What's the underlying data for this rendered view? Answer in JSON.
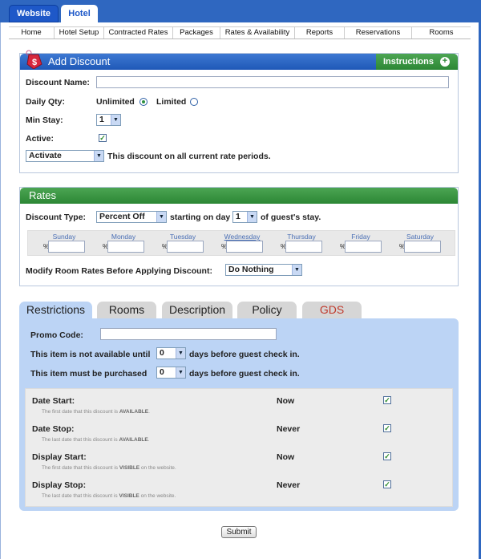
{
  "top_tabs": {
    "website": "Website",
    "hotel": "Hotel"
  },
  "nav": [
    "Home",
    "Hotel Setup",
    "Contracted Rates",
    "Packages",
    "Rates & Availability",
    "Reports",
    "Reservations",
    "Rooms"
  ],
  "add_discount": {
    "title": "Add Discount",
    "instructions": "Instructions",
    "discount_name_label": "Discount Name:",
    "discount_name_value": "",
    "daily_qty_label": "Daily Qty:",
    "unlimited": "Unlimited",
    "limited": "Limited",
    "min_stay_label": "Min Stay:",
    "min_stay_value": "1",
    "active_label": "Active:",
    "activate_value": "Activate",
    "activate_text": "This discount on all current rate periods."
  },
  "rates": {
    "title": "Rates",
    "discount_type_label": "Discount Type:",
    "discount_type_value": "Percent Off",
    "starting_on_day": "starting on day",
    "day_value": "1",
    "of_guest_stay": "of guest's stay.",
    "days": [
      "Sunday",
      "Monday",
      "Tuesday",
      "Wednesday",
      "Thursday",
      "Friday",
      "Saturday"
    ],
    "percent_symbol": "%",
    "modify_label": "Modify Room Rates Before Applying Discount:",
    "modify_value": "Do Nothing"
  },
  "tabs": [
    "Restrictions",
    "Rooms",
    "Description",
    "Policy",
    "GDS"
  ],
  "restrictions": {
    "promo_label": "Promo Code:",
    "not_available_label": "This item is not available until",
    "not_available_value": "0",
    "must_purchase_label": "This item must be purchased",
    "must_purchase_value": "0",
    "days_before": "days before guest check in.",
    "rows": [
      {
        "label": "Date Start:",
        "value": "Now",
        "hint_pre": "The first date that this discount is",
        "hint_key": "AVAILABLE",
        "hint_post": "."
      },
      {
        "label": "Date Stop:",
        "value": "Never",
        "hint_pre": "The last date that this discount is",
        "hint_key": "AVAILABLE",
        "hint_post": "."
      },
      {
        "label": "Display Start:",
        "value": "Now",
        "hint_pre": "The first date that this discount is",
        "hint_key": "VISIBLE",
        "hint_post": " on the website."
      },
      {
        "label": "Display Stop:",
        "value": "Never",
        "hint_pre": "The last date that this discount is",
        "hint_key": "VISIBLE",
        "hint_post": " on the website."
      }
    ]
  },
  "submit": "Submit",
  "colors": {
    "blue_header": "#2a63c3",
    "green_header": "#3a9843",
    "tab_active": "#bcd4f5",
    "gds_text": "#c0392b"
  }
}
